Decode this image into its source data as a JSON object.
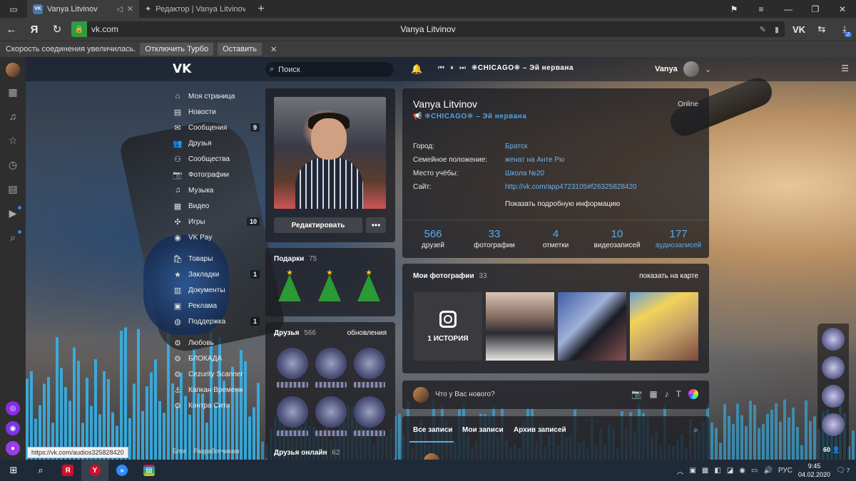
{
  "browser": {
    "tabs": [
      {
        "label": "Vanya Litvinov",
        "favicon": "VK"
      },
      {
        "label": "Редактор | Vanya Litvinov |",
        "favicon": "✦"
      }
    ],
    "address": {
      "host": "vk.com",
      "title": "Vanya Litvinov"
    },
    "downloads_badge": "2",
    "notification": {
      "message": "Скорость соединения увеличилась.",
      "btn_turbo_off": "Отключить Турбо",
      "btn_keep": "Оставить"
    },
    "status_url": "https://vk.com/audios325828420"
  },
  "vk": {
    "search_placeholder": "Поиск",
    "now_playing": "❋CHICAGO❋ – Эй нервана",
    "user_name": "Vanya",
    "menu": [
      {
        "label": "Моя страница",
        "icon": "home-icon",
        "count": ""
      },
      {
        "label": "Новости",
        "icon": "news-icon",
        "count": ""
      },
      {
        "label": "Сообщения",
        "icon": "messages-icon",
        "count": "9"
      },
      {
        "label": "Друзья",
        "icon": "friends-icon",
        "count": ""
      },
      {
        "label": "Сообщества",
        "icon": "communities-icon",
        "count": ""
      },
      {
        "label": "Фотографии",
        "icon": "camera-icon",
        "count": ""
      },
      {
        "label": "Музыка",
        "icon": "music-icon",
        "count": ""
      },
      {
        "label": "Видео",
        "icon": "video-icon",
        "count": ""
      },
      {
        "label": "Игры",
        "icon": "games-icon",
        "count": "10"
      },
      {
        "label": "VK Pay",
        "icon": "vkpay-icon",
        "count": ""
      },
      {
        "label": "Товары",
        "icon": "goods-icon",
        "count": ""
      },
      {
        "label": "Закладки",
        "icon": "star-icon",
        "count": "1"
      },
      {
        "label": "Документы",
        "icon": "docs-icon",
        "count": ""
      },
      {
        "label": "Реклама",
        "icon": "ads-icon",
        "count": ""
      },
      {
        "label": "Поддержка",
        "icon": "support-icon",
        "count": "1"
      },
      {
        "label": "Любовь",
        "icon": "gear-icon",
        "count": ""
      },
      {
        "label": "БЛОКАДА",
        "icon": "gear-icon",
        "count": ""
      },
      {
        "label": "Cezurity Scanner",
        "icon": "gear-icon",
        "count": ""
      },
      {
        "label": "Капкан Времени",
        "icon": "anchor-icon",
        "count": ""
      },
      {
        "label": "Контра Сити",
        "icon": "gear-icon",
        "count": ""
      }
    ],
    "footer": {
      "blog": "Блог",
      "developers": "Разработчикам"
    },
    "profile": {
      "edit_button": "Редактировать",
      "gifts_label": "Подарки",
      "gifts_count": "75",
      "friends_label": "Друзья",
      "friends_count": "566",
      "friends_updates": "обновления",
      "friends_online_label": "Друзья онлайн",
      "friends_online_count": "62"
    },
    "info": {
      "name": "Vanya Litvinov",
      "status": "Online",
      "track": "❋CHICAGO❋ – Эй нервана",
      "rows": [
        {
          "k": "Город:",
          "v": "Братск"
        },
        {
          "k": "Семейное положение:",
          "v": "женат на Анте Рю"
        },
        {
          "k": "Место учёбы:",
          "v": "Школа №20"
        },
        {
          "k": "Сайт:",
          "v": "http://vk.com/app4723105#f26325828420"
        }
      ],
      "more": "Показать подробную информацию",
      "stats": [
        {
          "n": "566",
          "l": "друзей"
        },
        {
          "n": "33",
          "l": "фотографии"
        },
        {
          "n": "4",
          "l": "отметки"
        },
        {
          "n": "10",
          "l": "видеозаписей"
        },
        {
          "n": "177",
          "l": "аудиозаписей"
        }
      ]
    },
    "photos": {
      "label": "Мои фотографии",
      "count": "33",
      "map_link": "показать на карте",
      "story_label": "1 ИСТОРИЯ"
    },
    "compose_placeholder": "Что у Вас нового?",
    "wall_tabs": [
      "Все записи",
      "Мои записи",
      "Архив записей"
    ],
    "right_rail_count": "60"
  },
  "taskbar": {
    "lang": "РУС",
    "time": "9:45",
    "date": "04.02.2020",
    "notifications": "7"
  },
  "colors": {
    "accent": "#5aabeb",
    "vk_blue": "#4a76a8",
    "yandex_red": "#d0102a"
  }
}
